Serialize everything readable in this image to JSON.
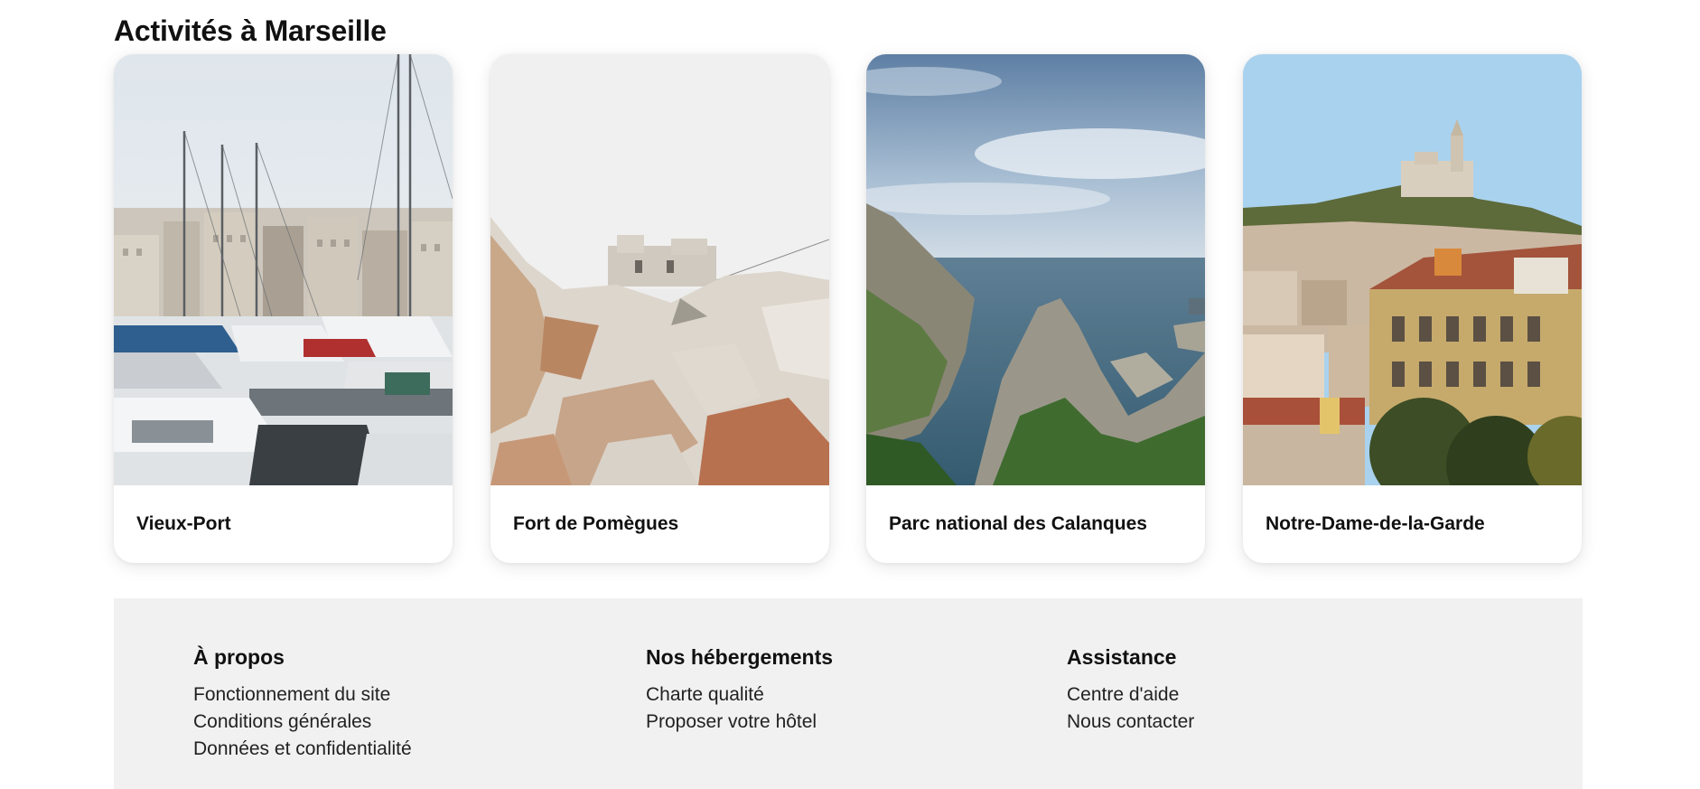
{
  "section": {
    "title": "Activités à Marseille"
  },
  "cards": [
    {
      "title": "Vieux-Port"
    },
    {
      "title": "Fort de Pomègues"
    },
    {
      "title": "Parc national des Calanques"
    },
    {
      "title": "Notre-Dame-de-la-Garde"
    }
  ],
  "footer": {
    "columns": [
      {
        "heading": "À propos",
        "links": [
          "Fonctionnement du site",
          "Conditions générales",
          "Données et confidentialité"
        ]
      },
      {
        "heading": "Nos hébergements",
        "links": [
          "Charte qualité",
          "Proposer votre hôtel"
        ]
      },
      {
        "heading": "Assistance",
        "links": [
          "Centre d'aide",
          "Nous contacter"
        ]
      }
    ]
  }
}
